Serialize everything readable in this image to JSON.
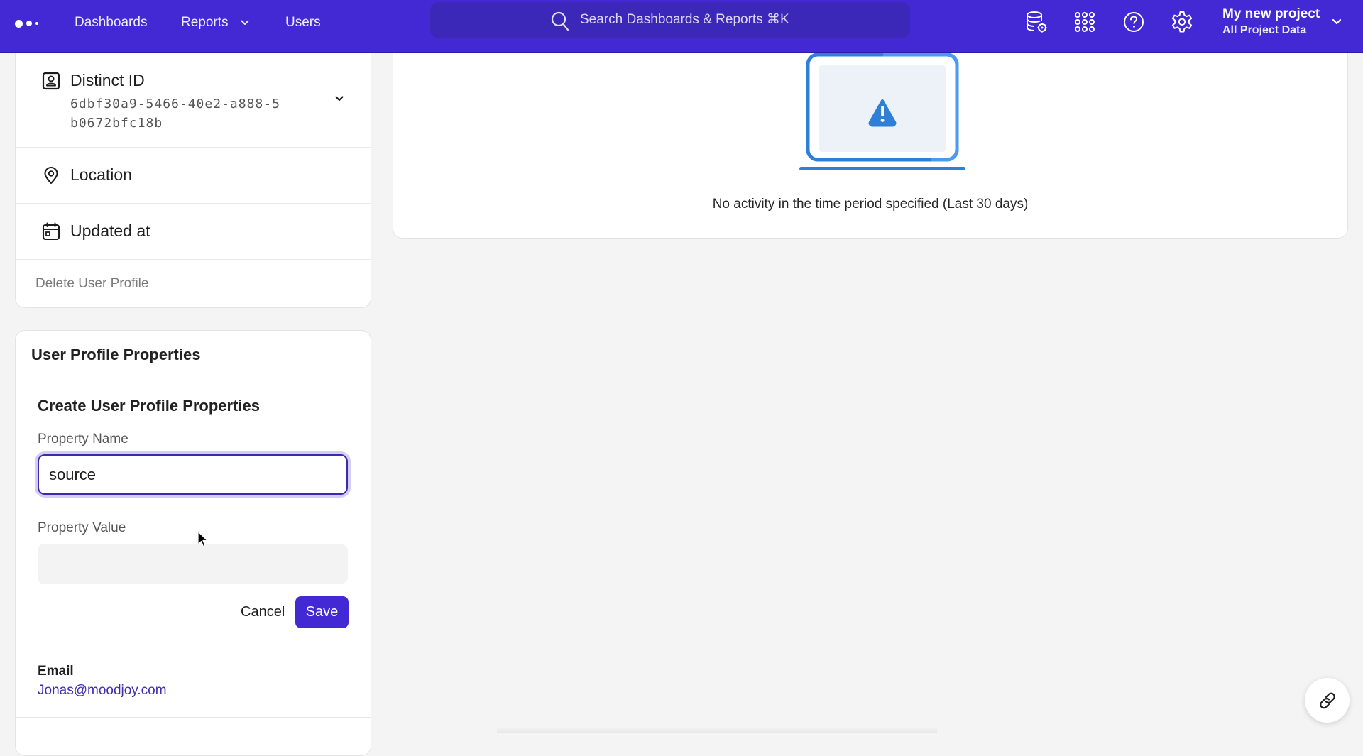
{
  "app": {
    "brand_color": "#4329d4",
    "link_color": "#3b2db0"
  },
  "topbar": {
    "logo_icon": "dots-logo",
    "nav": [
      {
        "label": "Dashboards"
      },
      {
        "label": "Reports",
        "has_dropdown": true
      },
      {
        "label": "Users"
      }
    ],
    "search": {
      "placeholder": "Search Dashboards & Reports ⌘K",
      "icon": "search-icon"
    },
    "icons": [
      "database-settings-icon",
      "apps-grid-icon",
      "help-icon",
      "gear-icon"
    ],
    "project": {
      "name": "My new project",
      "scope": "All Project Data"
    }
  },
  "profile_card": {
    "distinct_id": {
      "label": "Distinct ID",
      "value": "6dbf30a9-5466-40e2-a888-5b0672bfc18b",
      "icon": "user-badge-icon"
    },
    "location": {
      "label": "Location",
      "icon": "location-pin-icon"
    },
    "updated_at": {
      "label": "Updated at",
      "icon": "calendar-icon"
    },
    "delete_label": "Delete User Profile"
  },
  "properties_card": {
    "title": "User Profile Properties",
    "create": {
      "title": "Create User Profile Properties",
      "name_label": "Property Name",
      "name_value": "source",
      "value_label": "Property Value",
      "value_value": "",
      "cancel_label": "Cancel",
      "save_label": "Save"
    },
    "email": {
      "label": "Email",
      "value": "Jonas@moodjoy.com"
    }
  },
  "activity_card": {
    "illustration": "laptop-warning-icon",
    "message": "No activity in the time period specified (Last 30 days)"
  },
  "fab": {
    "icon": "link-icon"
  }
}
